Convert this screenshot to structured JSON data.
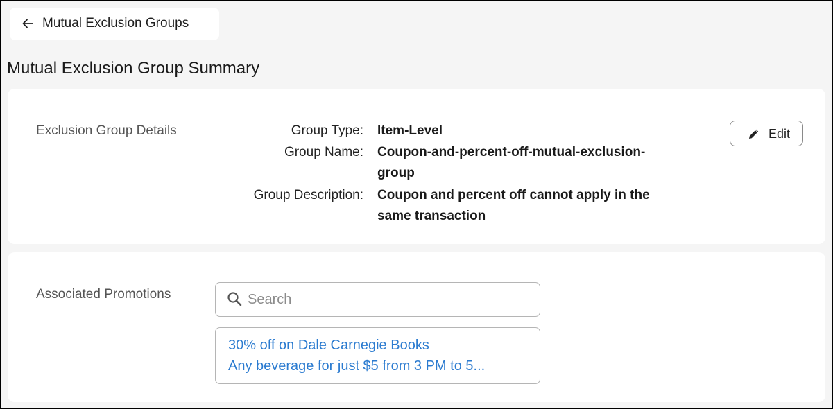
{
  "header": {
    "back_label": "Mutual Exclusion Groups",
    "page_title": "Mutual Exclusion Group Summary"
  },
  "details": {
    "section_label": "Exclusion Group Details",
    "edit_label": "Edit",
    "fields": [
      {
        "label": "Group Type:",
        "value": "Item-Level"
      },
      {
        "label": "Group Name:",
        "value_lines": [
          "Coupon-and-percent-off-mutual-exclusion-",
          "group"
        ]
      },
      {
        "label": "Group Description:",
        "value_lines": [
          "Coupon and percent off cannot apply in the",
          "same transaction"
        ]
      }
    ]
  },
  "associated": {
    "section_label": "Associated Promotions",
    "search": {
      "placeholder": "Search",
      "value": ""
    },
    "promotions": [
      "30% off on Dale Carnegie Books",
      "Any beverage for just $5 from 3 PM to 5..."
    ]
  },
  "colors": {
    "link": "#2b7bd0",
    "background": "#f5f5f5",
    "card": "#ffffff"
  }
}
